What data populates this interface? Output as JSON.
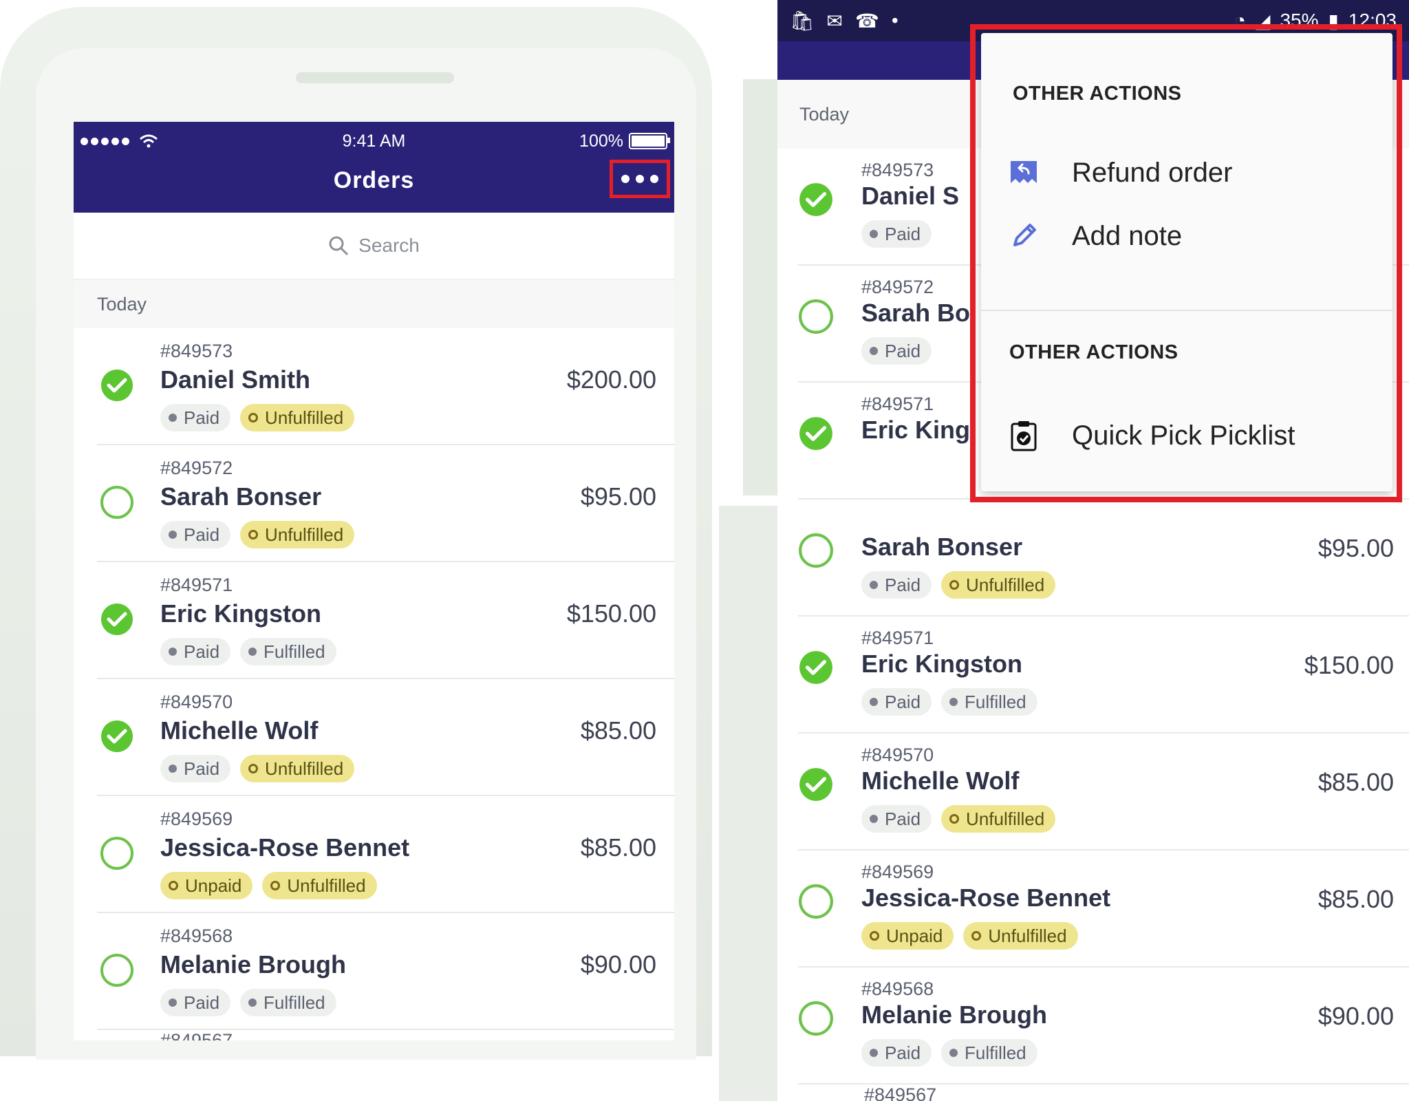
{
  "ios": {
    "status": {
      "time": "9:41 AM",
      "battery": "100%"
    },
    "title": "Orders",
    "search_placeholder": "Search",
    "section": "Today",
    "orders": [
      {
        "num": "#849573",
        "name": "Daniel Smith",
        "amount": "$200.00",
        "checked": true,
        "badges": [
          {
            "label": "Paid",
            "style": "grey"
          },
          {
            "label": "Unfulfilled",
            "style": "yellow"
          }
        ]
      },
      {
        "num": "#849572",
        "name": "Sarah Bonser",
        "amount": "$95.00",
        "checked": false,
        "badges": [
          {
            "label": "Paid",
            "style": "grey"
          },
          {
            "label": "Unfulfilled",
            "style": "yellow"
          }
        ]
      },
      {
        "num": "#849571",
        "name": "Eric Kingston",
        "amount": "$150.00",
        "checked": true,
        "badges": [
          {
            "label": "Paid",
            "style": "grey"
          },
          {
            "label": "Fulfilled",
            "style": "grey"
          }
        ]
      },
      {
        "num": "#849570",
        "name": "Michelle Wolf",
        "amount": "$85.00",
        "checked": true,
        "badges": [
          {
            "label": "Paid",
            "style": "grey"
          },
          {
            "label": "Unfulfilled",
            "style": "yellow"
          }
        ]
      },
      {
        "num": "#849569",
        "name": "Jessica-Rose Bennet",
        "amount": "$85.00",
        "checked": false,
        "badges": [
          {
            "label": "Unpaid",
            "style": "yellow"
          },
          {
            "label": "Unfulfilled",
            "style": "yellow"
          }
        ]
      },
      {
        "num": "#849568",
        "name": "Melanie Brough",
        "amount": "$90.00",
        "checked": false,
        "badges": [
          {
            "label": "Paid",
            "style": "grey"
          },
          {
            "label": "Fulfilled",
            "style": "grey"
          }
        ]
      }
    ],
    "partial_num": "#849567"
  },
  "android": {
    "status": {
      "battery": "35%",
      "time": "12:03",
      "app_icons": [
        "shopify-icon",
        "outlook-icon",
        "whatsapp-icon"
      ]
    },
    "section": "Today",
    "orders": [
      {
        "num": "#849573",
        "name": "Daniel S",
        "checked": true,
        "badges": [
          {
            "label": "Paid",
            "style": "grey"
          }
        ]
      },
      {
        "num": "#849572",
        "name": "Sarah Bo",
        "checked": false,
        "badges": [
          {
            "label": "Paid",
            "style": "grey"
          }
        ]
      },
      {
        "num": "#849571",
        "name": "Eric King",
        "checked": true,
        "badges": []
      },
      {
        "num": "",
        "name": "Sarah Bonser",
        "amount": "$95.00",
        "checked": false,
        "badges": [
          {
            "label": "Paid",
            "style": "grey"
          },
          {
            "label": "Unfulfilled",
            "style": "yellow"
          }
        ]
      },
      {
        "num": "#849571",
        "name": "Eric Kingston",
        "amount": "$150.00",
        "checked": true,
        "badges": [
          {
            "label": "Paid",
            "style": "grey"
          },
          {
            "label": "Fulfilled",
            "style": "grey"
          }
        ]
      },
      {
        "num": "#849570",
        "name": "Michelle Wolf",
        "amount": "$85.00",
        "checked": true,
        "badges": [
          {
            "label": "Paid",
            "style": "grey"
          },
          {
            "label": "Unfulfilled",
            "style": "yellow"
          }
        ]
      },
      {
        "num": "#849569",
        "name": "Jessica-Rose Bennet",
        "amount": "$85.00",
        "checked": false,
        "badges": [
          {
            "label": "Unpaid",
            "style": "yellow"
          },
          {
            "label": "Unfulfilled",
            "style": "yellow"
          }
        ]
      },
      {
        "num": "#849568",
        "name": "Melanie Brough",
        "amount": "$90.00",
        "checked": false,
        "badges": [
          {
            "label": "Paid",
            "style": "grey"
          },
          {
            "label": "Fulfilled",
            "style": "grey"
          }
        ]
      }
    ],
    "partial_num": "#849567"
  },
  "menu": {
    "header_1": "OTHER ACTIONS",
    "refund": "Refund order",
    "add_note": "Add note",
    "header_2": "OTHER ACTIONS",
    "picklist": "Quick Pick Picklist"
  },
  "colors": {
    "header": "#2a2179",
    "highlight": "#e3202a",
    "check_green": "#5cc532",
    "badge_yellow": "#eee58e",
    "refund_icon": "#5b6fd6",
    "pencil_icon": "#5b6fd6"
  }
}
